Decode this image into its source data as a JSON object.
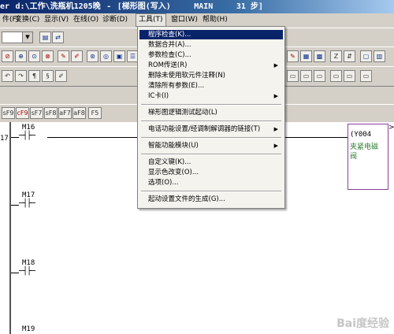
{
  "title": {
    "app": "er",
    "path": "d:\\工作\\洗瓶机1205晚",
    "view": "[梯形图(写入)",
    "program": "MAIN",
    "steps": "31 步]"
  },
  "menubar": [
    {
      "label": "件(F)"
    },
    {
      "label": "变换(C)"
    },
    {
      "label": "显示(V)"
    },
    {
      "label": "在线(O)"
    },
    {
      "label": "诊断(D)"
    },
    {
      "label": "工具(T)",
      "active": true
    },
    {
      "label": "窗口(W)"
    },
    {
      "label": "帮助(H)"
    }
  ],
  "toolbar_func_keys": [
    "sF9",
    "cF9",
    "sF7",
    "sF8",
    "aF7",
    "aF8"
  ],
  "tools_menu": {
    "items": [
      {
        "label": "程序检查(K)...",
        "highlighted": true,
        "submenu": false
      },
      {
        "label": "数据合并(A)...",
        "submenu": false
      },
      {
        "label": "参数检查(C)...",
        "submenu": false
      },
      {
        "label": "ROM传送(R)",
        "submenu": true
      },
      {
        "label": "删除未使用软元件注释(N)",
        "submenu": false
      },
      {
        "label": "清除所有参数(E)...",
        "submenu": false
      },
      {
        "label": "IC卡(I)",
        "submenu": true
      },
      {
        "label": "梯形图逻辑测试起动(L)",
        "submenu": false
      },
      {
        "label": "电话功能设置/经调制解调器的链接(T)",
        "submenu": true
      },
      {
        "label": "智能功能模块(U)",
        "submenu": true
      },
      {
        "label": "自定义键(K)...",
        "submenu": false
      },
      {
        "label": "显示色改变(O)...",
        "submenu": false
      },
      {
        "label": "选项(O)...",
        "submenu": false
      },
      {
        "label": "起动设置文件的生成(G)...",
        "submenu": false
      }
    ]
  },
  "ladder": {
    "step_number": "17",
    "contacts": [
      "M16",
      "M17",
      "M18",
      "M19"
    ],
    "coil": {
      "device": "Y004",
      "comment_line1": "夹紧电磁",
      "comment_line2": "阀"
    }
  },
  "watermark": "Bai度经验",
  "colors": {
    "titlebar": "#0a246a",
    "highlight": "#0a246a",
    "coil_border": "#8a3e9a",
    "coil_text": "#2e7d32"
  }
}
